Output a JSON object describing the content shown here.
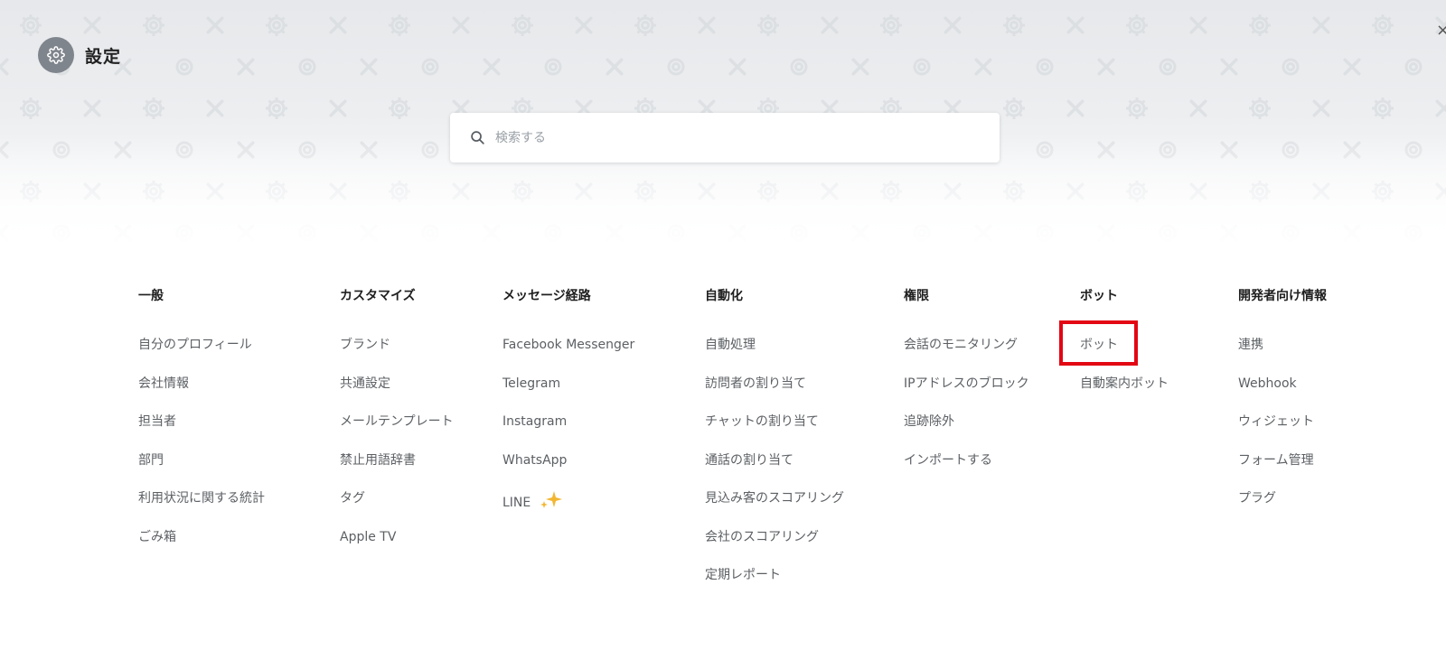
{
  "header": {
    "title": "設定",
    "settings_icon": "gear-icon",
    "close_label": "×"
  },
  "search": {
    "placeholder": "検索する",
    "value": ""
  },
  "columns": [
    {
      "heading": "一般",
      "items": [
        "自分のプロフィール",
        "会社情報",
        "担当者",
        "部門",
        "利用状況に関する統計",
        "ごみ箱"
      ]
    },
    {
      "heading": "カスタマイズ",
      "items": [
        "ブランド",
        "共通設定",
        "メールテンプレート",
        "禁止用語辞書",
        "タグ",
        "Apple TV"
      ]
    },
    {
      "heading": "メッセージ経路",
      "items": [
        "Facebook Messenger",
        "Telegram",
        "Instagram",
        "WhatsApp",
        "LINE"
      ]
    },
    {
      "heading": "自動化",
      "items": [
        "自動処理",
        "訪問者の割り当て",
        "チャットの割り当て",
        "通話の割り当て",
        "見込み客のスコアリング",
        "会社のスコアリング",
        "定期レポート"
      ]
    },
    {
      "heading": "権限",
      "items": [
        "会話のモニタリング",
        "IPアドレスのブロック",
        "追跡除外",
        "インポートする"
      ]
    },
    {
      "heading": "ボット",
      "items": [
        "ボット",
        "自動案内ボット"
      ]
    },
    {
      "heading": "開発者向け情報",
      "items": [
        "連携",
        "Webhook",
        "ウィジェット",
        "フォーム管理",
        "プラグ"
      ]
    }
  ],
  "line_badge_icon": "sparkle-icon",
  "highlight": {
    "target": "ボット",
    "color": "#e30613"
  }
}
